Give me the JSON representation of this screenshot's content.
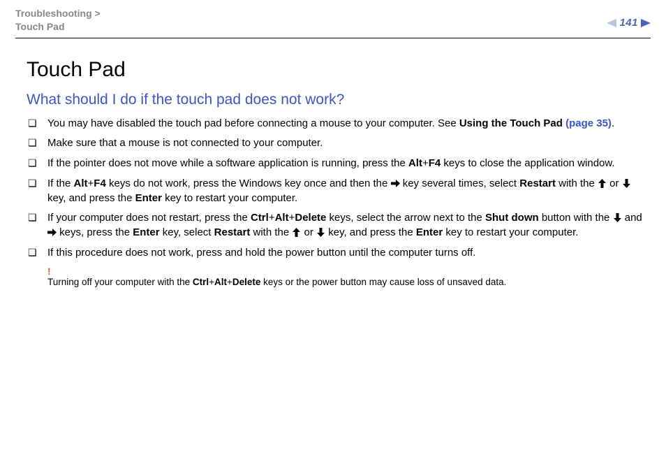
{
  "header": {
    "breadcrumb_line1": "Troubleshooting >",
    "breadcrumb_line2": "Touch Pad",
    "page_number": "141"
  },
  "content": {
    "title": "Touch Pad",
    "subtitle": "What should I do if the touch pad does not work?",
    "bullets": {
      "b1_a": "You may have disabled the touch pad before connecting a mouse to your computer. See ",
      "b1_b": "Using the Touch Pad ",
      "b1_link": "(page 35)",
      "b1_c": ".",
      "b2": "Make sure that a mouse is not connected to your computer.",
      "b3_a": "If the pointer does not move while a software application is running, press the ",
      "b3_b": "Alt",
      "b3_c": "+",
      "b3_d": "F4",
      "b3_e": " keys to close the application window.",
      "b4_a": "If the ",
      "b4_b": "Alt",
      "b4_c": "+",
      "b4_d": "F4",
      "b4_e": " keys do not work, press the Windows key once and then the ",
      "b4_f": " key several times, select ",
      "b4_g": "Restart",
      "b4_h": " with the ",
      "b4_i": " or ",
      "b4_j": " key, and press the ",
      "b4_k": "Enter",
      "b4_l": " key to restart your computer.",
      "b5_a": "If your computer does not restart, press the ",
      "b5_b": "Ctrl",
      "b5_c": "+",
      "b5_d": "Alt",
      "b5_e": "+",
      "b5_f": "Delete",
      "b5_g": " keys, select the arrow next to the ",
      "b5_h": "Shut down",
      "b5_i": " button with the ",
      "b5_j": " and ",
      "b5_k": " keys, press the ",
      "b5_l": "Enter",
      "b5_m": " key, select ",
      "b5_n": "Restart",
      "b5_o": " with the ",
      "b5_p": " or ",
      "b5_q": " key, and press the ",
      "b5_r": "Enter",
      "b5_s": " key to restart your computer.",
      "b6": "If this procedure does not work, press and hold the power button until the computer turns off."
    },
    "note": {
      "mark": "!",
      "text_a": "Turning off your computer with the ",
      "text_b": "Ctrl",
      "text_c": "+",
      "text_d": "Alt",
      "text_e": "+",
      "text_f": "Delete",
      "text_g": " keys or the power button may cause loss of unsaved data."
    }
  }
}
